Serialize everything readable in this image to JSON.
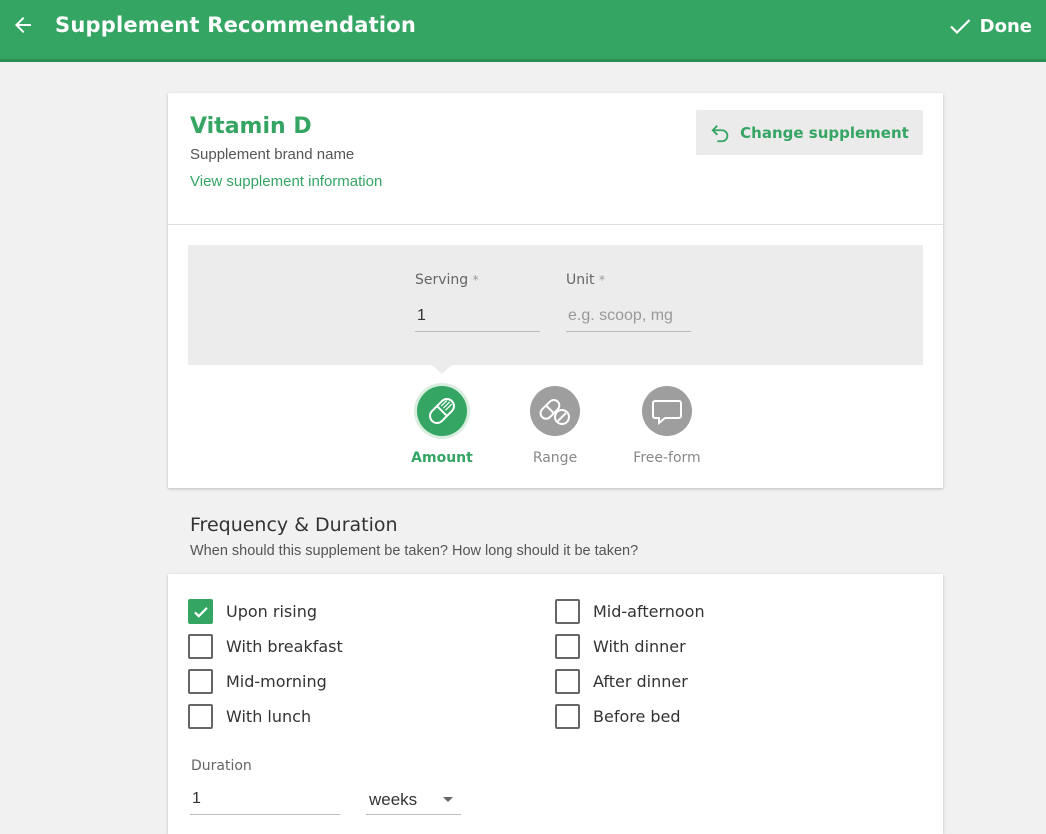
{
  "header": {
    "title": "Supplement Recommendation",
    "done_label": "Done",
    "bg_color": "#34a563"
  },
  "supplement": {
    "name": "Vitamin D",
    "brand": "Supplement brand name",
    "view_info_label": "View supplement information",
    "change_label": "Change supplement"
  },
  "serving": {
    "serving_label": "Serving",
    "serving_value": "1",
    "unit_label": "Unit",
    "unit_value": "",
    "unit_placeholder": "e.g. scoop, mg",
    "required_mark": "*"
  },
  "modes": {
    "selected": "Amount",
    "items": [
      {
        "label": "Amount",
        "icon": "pill-icon"
      },
      {
        "label": "Range",
        "icon": "pills-icon"
      },
      {
        "label": "Free-form",
        "icon": "speech-bubble-icon"
      }
    ]
  },
  "frequency": {
    "title": "Frequency & Duration",
    "subtitle": "When should this supplement be taken? How long should it be taken?",
    "options": [
      {
        "label": "Upon rising",
        "checked": true
      },
      {
        "label": "With breakfast",
        "checked": false
      },
      {
        "label": "Mid-morning",
        "checked": false
      },
      {
        "label": "With lunch",
        "checked": false
      },
      {
        "label": "Mid-afternoon",
        "checked": false
      },
      {
        "label": "With dinner",
        "checked": false
      },
      {
        "label": "After dinner",
        "checked": false
      },
      {
        "label": "Before bed",
        "checked": false
      }
    ]
  },
  "duration": {
    "label": "Duration",
    "value": "1",
    "unit": "weeks"
  }
}
